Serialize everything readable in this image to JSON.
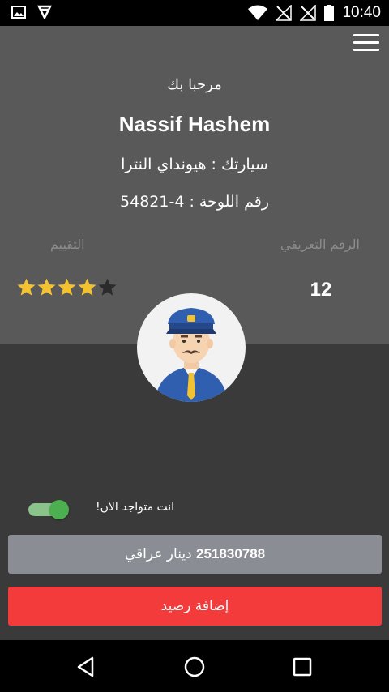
{
  "status_bar": {
    "time": "10:40",
    "left_icons": [
      "image-icon",
      "app-notification-icon"
    ],
    "right_icons": [
      "wifi-icon",
      "no-signal-icon",
      "no-signal-icon",
      "battery-icon"
    ]
  },
  "header": {
    "welcome": "مرحبا بك",
    "name": "Nassif Hashem",
    "car": "سيارتك : هيونداي النترا",
    "plate": "رقم اللوحة : 4-54821",
    "id_label": "الرقم التعريفي",
    "rating_label": "التقييم",
    "id_value": "12",
    "rating": 4,
    "rating_max": 5
  },
  "availability": {
    "label": "انت متواجد الان!",
    "on": true
  },
  "balance": {
    "amount": "251830788",
    "currency": "دينار عراقي"
  },
  "actions": {
    "add_balance": "إضافة رصيد"
  },
  "colors": {
    "panel": "#595959",
    "background": "#3a3a3a",
    "star": "#f2c230",
    "add_button": "#f43b3b",
    "balance_box": "#8a8d94",
    "toggle": "#4caf50"
  }
}
